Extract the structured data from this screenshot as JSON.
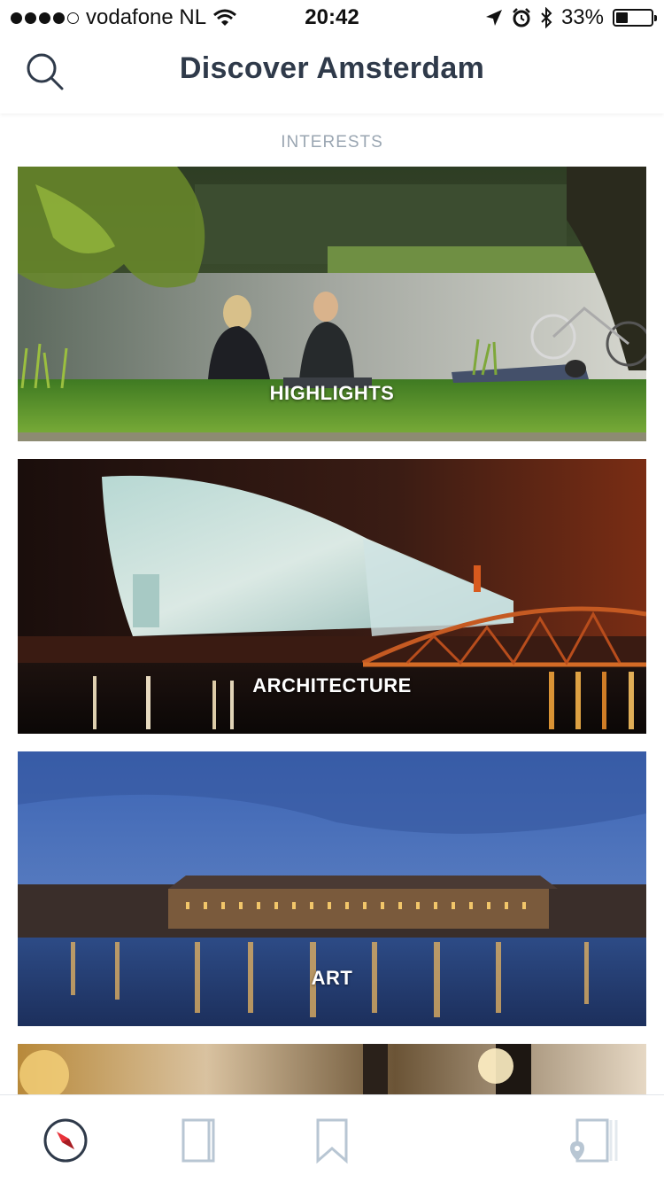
{
  "status_bar": {
    "carrier": "vodafone NL",
    "time": "20:42",
    "battery": "33%",
    "battery_level": 0.33
  },
  "header": {
    "title": "Discover Amsterdam",
    "search_icon": "search-icon"
  },
  "section": {
    "label": "INTERESTS"
  },
  "cards": [
    {
      "label": "HIGHLIGHTS"
    },
    {
      "label": "ARCHITECTURE"
    },
    {
      "label": "ART"
    },
    {
      "label": ""
    }
  ],
  "tab_bar": {
    "items": [
      {
        "icon": "compass-icon",
        "active": true
      },
      {
        "icon": "book-icon",
        "active": false
      },
      {
        "icon": "bookmark-icon",
        "active": false
      },
      {
        "icon": "map-guide-icon",
        "active": false
      }
    ],
    "active_color": "#e8323a",
    "inactive_color": "#b8c6d3"
  }
}
